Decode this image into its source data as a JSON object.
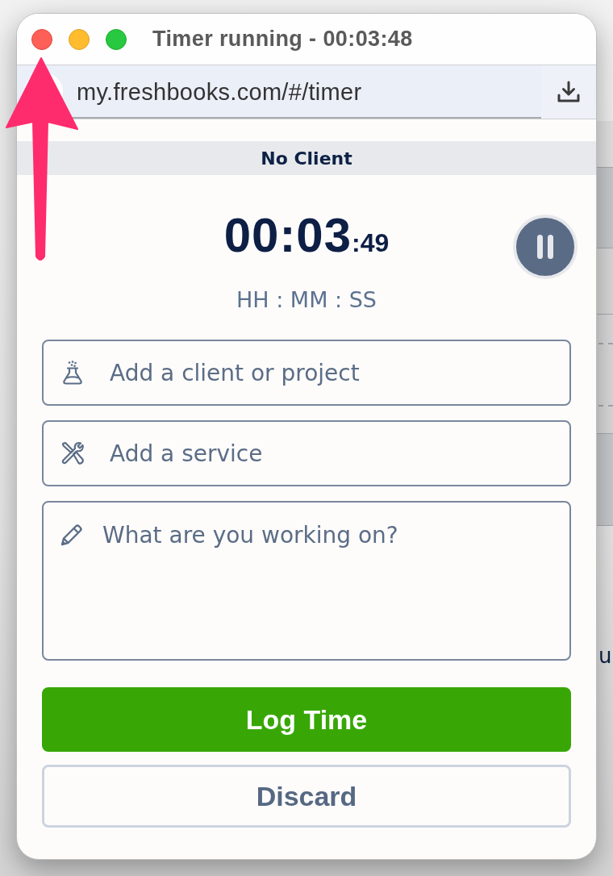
{
  "window": {
    "title": "Timer running - 00:03:48"
  },
  "address_bar": {
    "url": "my.freshbooks.com/#/timer"
  },
  "client_banner": {
    "label": "No Client"
  },
  "timer": {
    "main": "00:03",
    "seconds": ":49",
    "format_hint": "HH : MM : SS",
    "running": true
  },
  "fields": [
    {
      "kind": "client",
      "placeholder": "Add a client or project"
    },
    {
      "kind": "service",
      "placeholder": "Add a service"
    },
    {
      "kind": "notes",
      "placeholder": "What are you working on?"
    }
  ],
  "actions": [
    {
      "kind": "primary",
      "label": "Log Time"
    },
    {
      "kind": "secondary",
      "label": "Discard"
    }
  ],
  "background_page": {
    "text_fragment": "u"
  }
}
